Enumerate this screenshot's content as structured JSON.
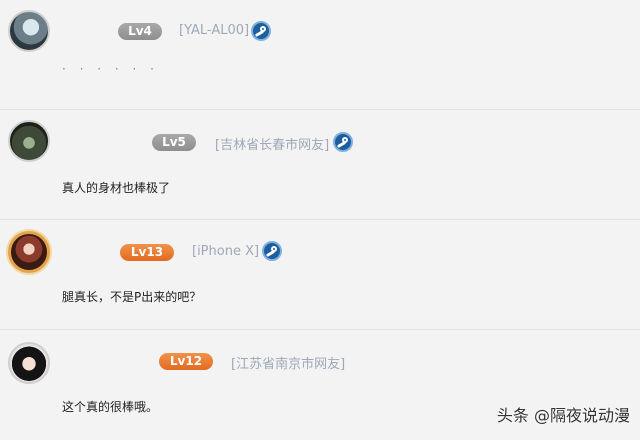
{
  "comments": [
    {
      "level": "Lv4",
      "location": "[YAL-AL00]",
      "text": "· · · · · ·"
    },
    {
      "level": "Lv5",
      "location": "[吉林省长春市网友]",
      "text": "真人的身材也棒极了"
    },
    {
      "level": "Lv13",
      "location": "[iPhone X]",
      "text": "腿真长，不是P出来的吧？"
    },
    {
      "level": "Lv12",
      "location": "[江苏省南京市网友]",
      "text": "这个真的很棒哦。"
    }
  ],
  "watermark": "头条 @隔夜说动漫",
  "colors": {
    "level_gray": "#9b9b9b",
    "level_orange": "#e8762c",
    "location": "#9ea8b8"
  }
}
